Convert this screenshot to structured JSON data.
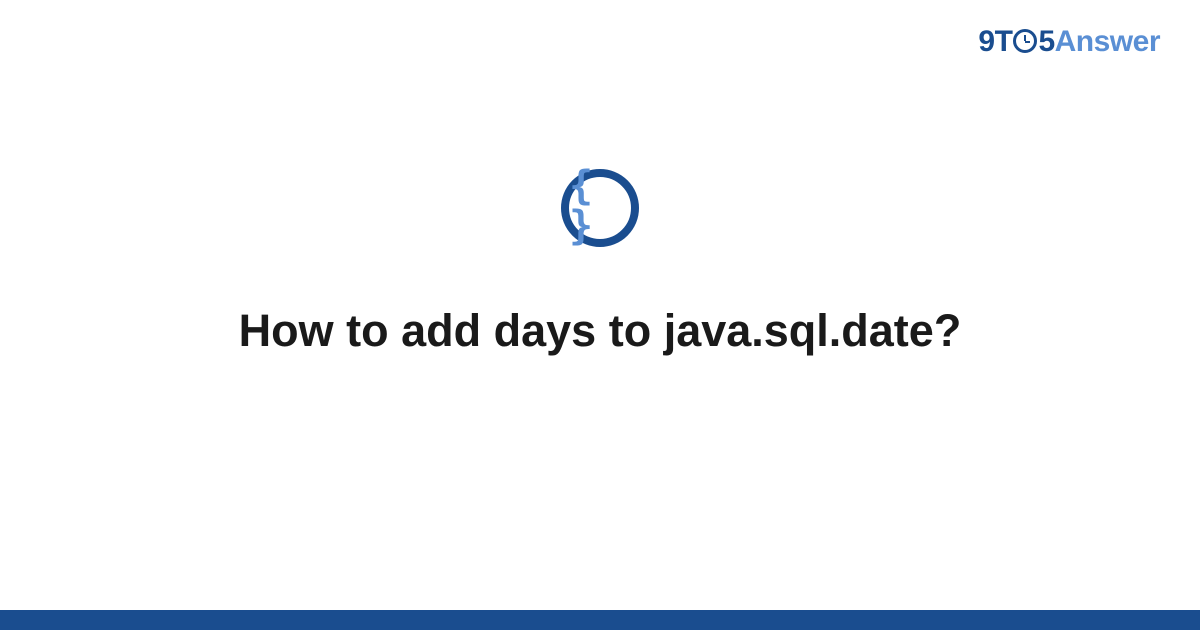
{
  "logo": {
    "prefix_9": "9",
    "prefix_t": "T",
    "suffix_5": "5",
    "word": "Answer"
  },
  "icon": {
    "symbol": "{ }",
    "name": "code-braces"
  },
  "question": {
    "title": "How to add days to java.sql.date?"
  },
  "colors": {
    "brand_dark": "#1a4d8f",
    "brand_light": "#5a8fd4",
    "text": "#1a1a1a",
    "background": "#ffffff"
  }
}
